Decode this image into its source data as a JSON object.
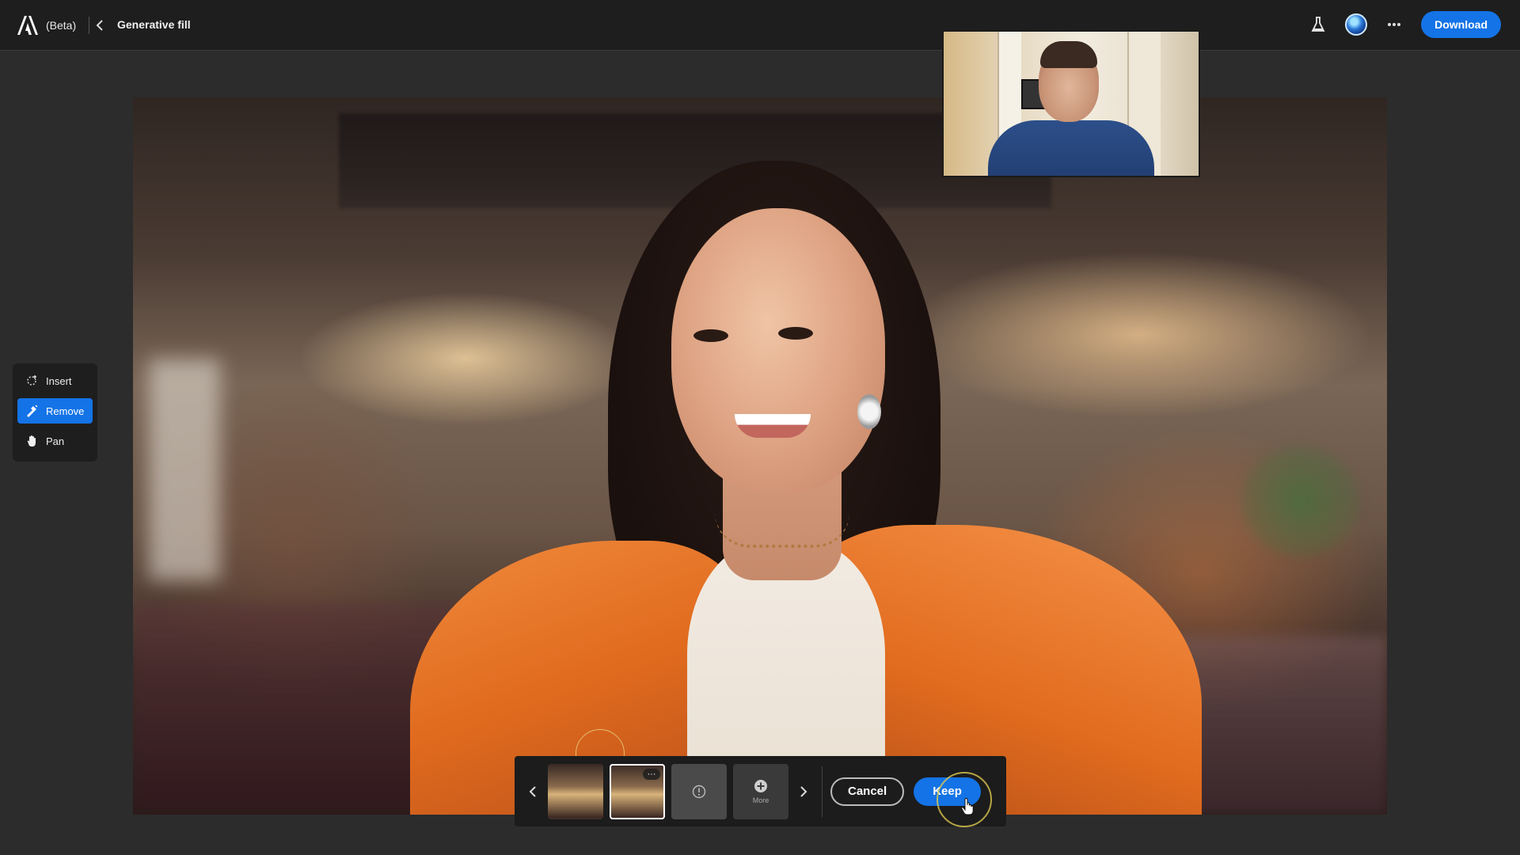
{
  "app": {
    "beta_label": "(Beta)",
    "title": "Generative fill"
  },
  "topbar": {
    "download_label": "Download",
    "icons": [
      "adobe-logo-icon",
      "back-chevron-icon",
      "flask-icon",
      "avatar",
      "more-icon"
    ]
  },
  "tools": [
    {
      "label": "Insert",
      "icon": "insert-icon",
      "active": false
    },
    {
      "label": "Remove",
      "icon": "remove-icon",
      "active": true
    },
    {
      "label": "Pan",
      "icon": "hand-icon",
      "active": false
    }
  ],
  "generation_bar": {
    "more_label": "More",
    "cancel_label": "Cancel",
    "keep_label": "Keep",
    "thumb_more_glyph": "···",
    "variations": [
      {
        "name": "variation-1",
        "selected": false
      },
      {
        "name": "variation-2",
        "selected": true
      }
    ]
  },
  "colors": {
    "accent": "#1473e6",
    "topbar": "#1e1e1e",
    "workspace": "#2c2c2c"
  }
}
